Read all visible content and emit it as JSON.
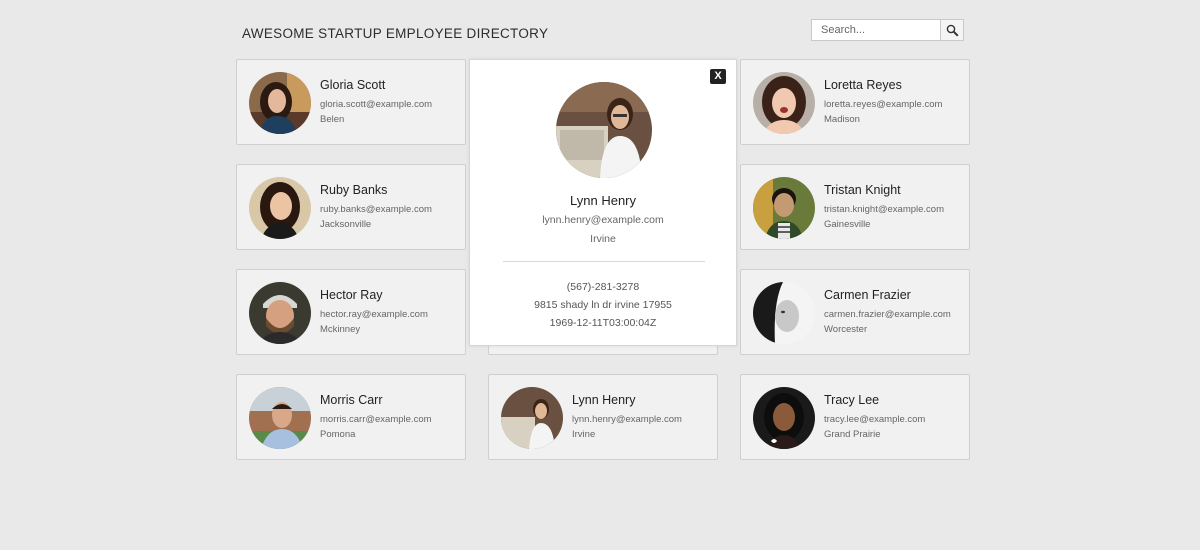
{
  "header": {
    "title": "AWESOME STARTUP EMPLOYEE DIRECTORY",
    "search_placeholder": "Search...",
    "search_icon": "magnifier-icon"
  },
  "employees": [
    {
      "name": "Gloria Scott",
      "email": "gloria.scott@example.com",
      "city": "Belen"
    },
    {
      "name": "Loretta Reyes",
      "email": "loretta.reyes@example.com",
      "city": "Madison"
    },
    {
      "name": "Ruby Banks",
      "email": "ruby.banks@example.com",
      "city": "Jacksonville"
    },
    {
      "name": "Tristan Knight",
      "email": "tristan.knight@example.com",
      "city": "Gainesville"
    },
    {
      "name": "Hector Ray",
      "email": "hector.ray@example.com",
      "city": "Mckinney"
    },
    {
      "name": "Carmen Frazier",
      "email": "carmen.frazier@example.com",
      "city": "Worcester"
    },
    {
      "name": "Morris Carr",
      "email": "morris.carr@example.com",
      "city": "Pomona"
    },
    {
      "name": "Lynn Henry",
      "email": "lynn.henry@example.com",
      "city": "Irvine"
    },
    {
      "name": "Tracy Lee",
      "email": "tracy.lee@example.com",
      "city": "Grand Prairie"
    }
  ],
  "modal": {
    "close_label": "X",
    "name": "Lynn Henry",
    "email": "lynn.henry@example.com",
    "city": "Irvine",
    "phone": "(567)-281-3278",
    "address": "9815 shady ln dr irvine 17955",
    "birthday": "1969-12-11T03:00:04Z"
  },
  "colors": {
    "background": "#e9e9e9",
    "card": "#f1f1f1",
    "card_border": "#cfcfcf",
    "modal": "#ffffff",
    "close_button": "#222222"
  }
}
